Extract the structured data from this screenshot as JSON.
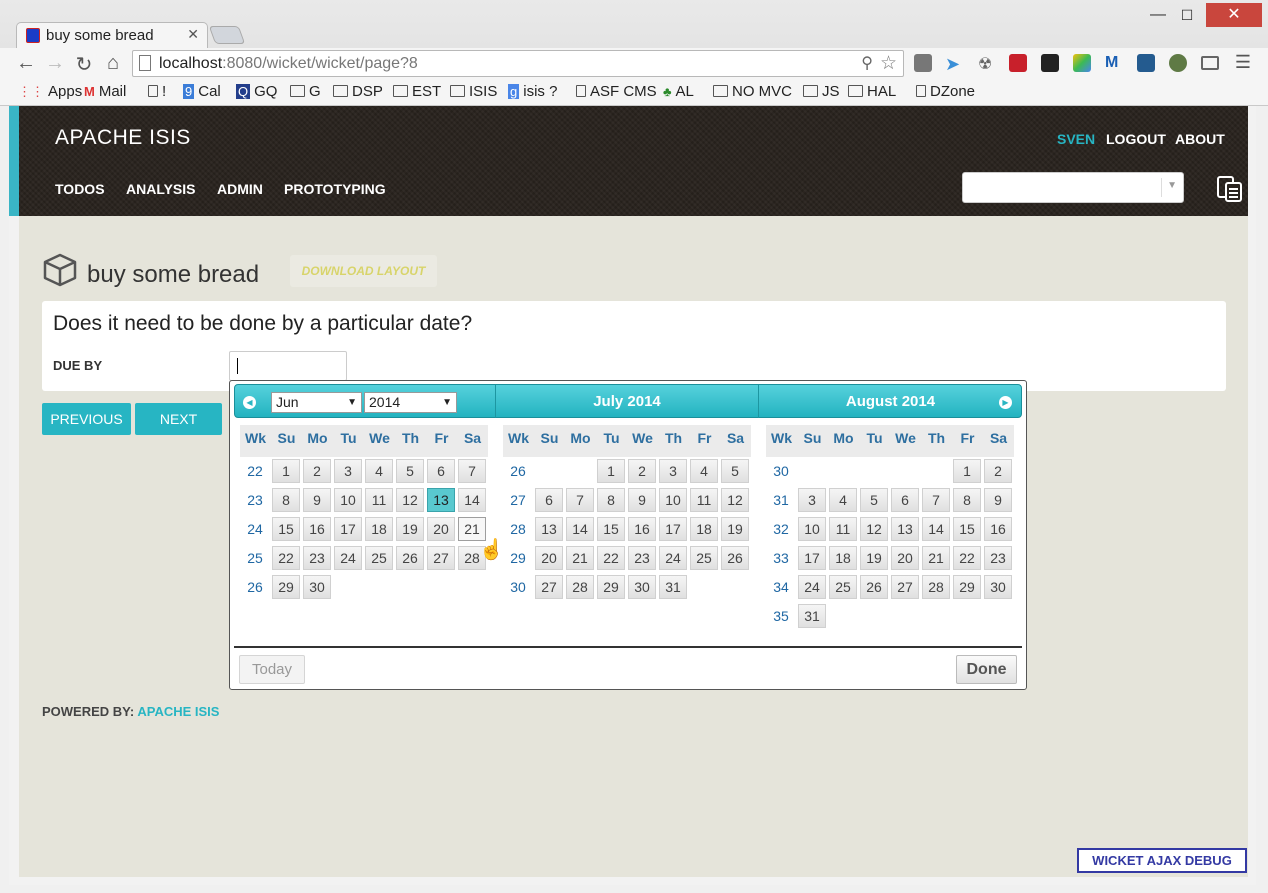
{
  "browser": {
    "tab_title": "buy some bread",
    "url_host": "localhost",
    "url_rest": ":8080/wicket/wicket/page?8",
    "bookmarks": [
      "Apps",
      "Mail",
      "!",
      "Cal",
      "GQ",
      "G",
      "DSP",
      "EST",
      "ISIS",
      "isis ?",
      "ASF CMS",
      "AL",
      "NO MVC",
      "JS",
      "HAL",
      "DZone"
    ]
  },
  "header": {
    "brand": "APACHE ISIS",
    "menu": [
      "TODOS",
      "ANALYSIS",
      "ADMIN",
      "PROTOTYPING"
    ],
    "user": "SVEN",
    "logout": "LOGOUT",
    "about": "ABOUT",
    "accent_color": "#3ab5c5"
  },
  "object": {
    "title": "buy some bread",
    "download_layout": "DOWNLOAD LAYOUT"
  },
  "form": {
    "question": "Does it need to be done by a particular date?",
    "due_label": "DUE BY",
    "due_value": ""
  },
  "buttons": {
    "previous": "PREVIOUS",
    "next": "NEXT"
  },
  "footer": {
    "powered_by": "POWERED BY:",
    "powered_link": "APACHE ISIS",
    "debug": "WICKET AJAX DEBUG"
  },
  "datepicker": {
    "month_select": "Jun",
    "year_select": "2014",
    "weekday_headers": [
      "Wk",
      "Su",
      "Mo",
      "Tu",
      "We",
      "Th",
      "Fr",
      "Sa"
    ],
    "today": "Today",
    "done": "Done",
    "selected_day": "13",
    "hover_day": "21",
    "months": [
      {
        "title": "",
        "weeks": [
          {
            "wk": "22",
            "days": [
              "1",
              "2",
              "3",
              "4",
              "5",
              "6",
              "7"
            ]
          },
          {
            "wk": "23",
            "days": [
              "8",
              "9",
              "10",
              "11",
              "12",
              "13",
              "14"
            ]
          },
          {
            "wk": "24",
            "days": [
              "15",
              "16",
              "17",
              "18",
              "19",
              "20",
              "21"
            ]
          },
          {
            "wk": "25",
            "days": [
              "22",
              "23",
              "24",
              "25",
              "26",
              "27",
              "28"
            ]
          },
          {
            "wk": "26",
            "days": [
              "29",
              "30",
              "",
              "",
              "",
              "",
              ""
            ]
          }
        ]
      },
      {
        "title": "July 2014",
        "weeks": [
          {
            "wk": "26",
            "days": [
              "",
              "",
              "1",
              "2",
              "3",
              "4",
              "5"
            ]
          },
          {
            "wk": "27",
            "days": [
              "6",
              "7",
              "8",
              "9",
              "10",
              "11",
              "12"
            ]
          },
          {
            "wk": "28",
            "days": [
              "13",
              "14",
              "15",
              "16",
              "17",
              "18",
              "19"
            ]
          },
          {
            "wk": "29",
            "days": [
              "20",
              "21",
              "22",
              "23",
              "24",
              "25",
              "26"
            ]
          },
          {
            "wk": "30",
            "days": [
              "27",
              "28",
              "29",
              "30",
              "31",
              "",
              ""
            ]
          }
        ]
      },
      {
        "title": "August 2014",
        "weeks": [
          {
            "wk": "30",
            "days": [
              "",
              "",
              "",
              "",
              "",
              "1",
              "2"
            ]
          },
          {
            "wk": "31",
            "days": [
              "3",
              "4",
              "5",
              "6",
              "7",
              "8",
              "9"
            ]
          },
          {
            "wk": "32",
            "days": [
              "10",
              "11",
              "12",
              "13",
              "14",
              "15",
              "16"
            ]
          },
          {
            "wk": "33",
            "days": [
              "17",
              "18",
              "19",
              "20",
              "21",
              "22",
              "23"
            ]
          },
          {
            "wk": "34",
            "days": [
              "24",
              "25",
              "26",
              "27",
              "28",
              "29",
              "30"
            ]
          },
          {
            "wk": "35",
            "days": [
              "31",
              "",
              "",
              "",
              "",
              "",
              ""
            ]
          }
        ]
      }
    ]
  }
}
